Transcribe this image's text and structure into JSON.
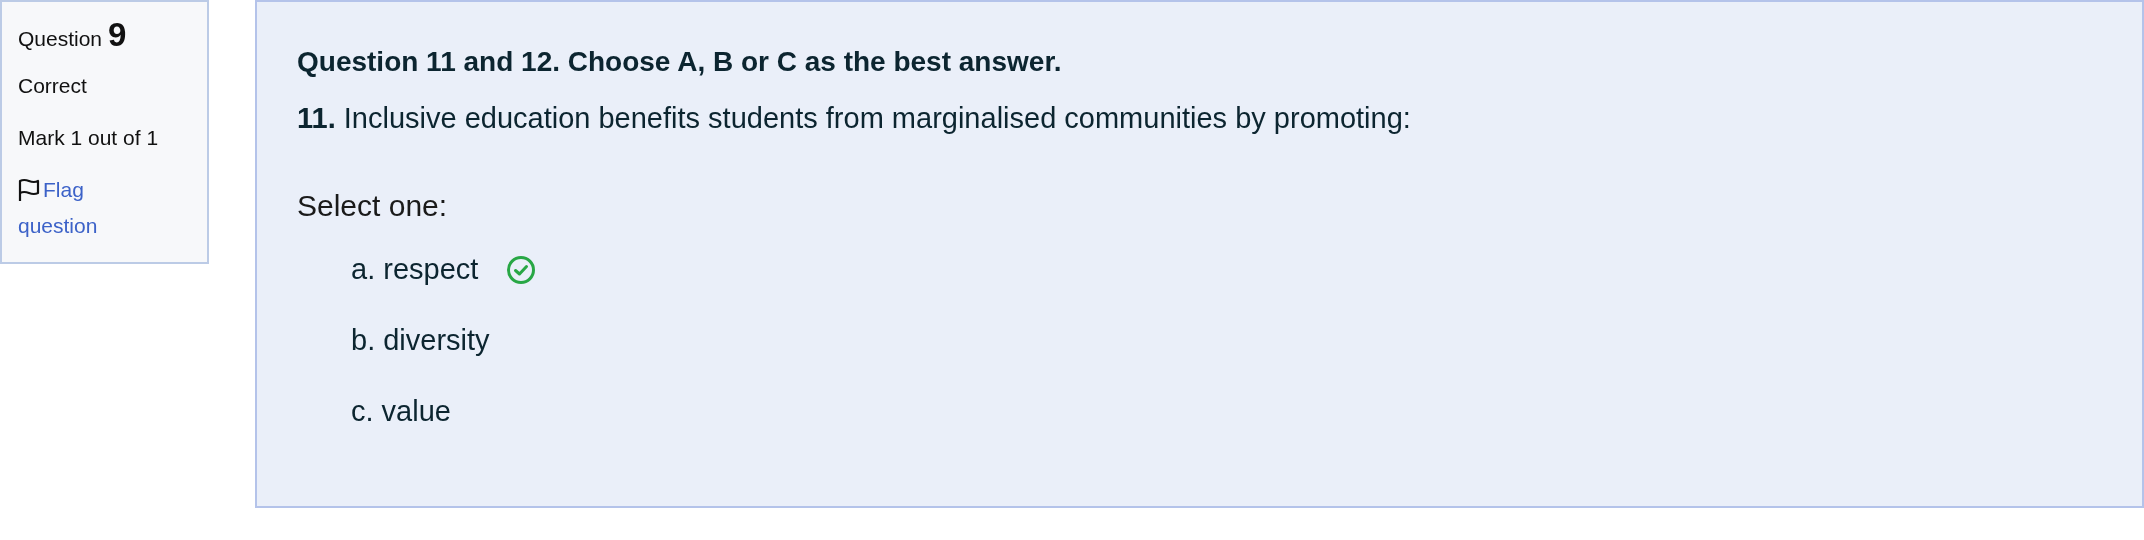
{
  "info": {
    "label": "Question",
    "number": "9",
    "state": "Correct",
    "mark": "Mark 1 out of 1",
    "flag": "Flag question"
  },
  "question": {
    "heading": "Question 11 and 12. Choose A, B or C as the best answer.",
    "text": "**11.** Inclusive education benefits students from marginalised communities by promoting:",
    "prompt": "Select one:",
    "options": [
      {
        "label": "a. respect",
        "correct": true
      },
      {
        "label": "b. diversity",
        "correct": false
      },
      {
        "label": "c. value",
        "correct": false
      }
    ]
  }
}
